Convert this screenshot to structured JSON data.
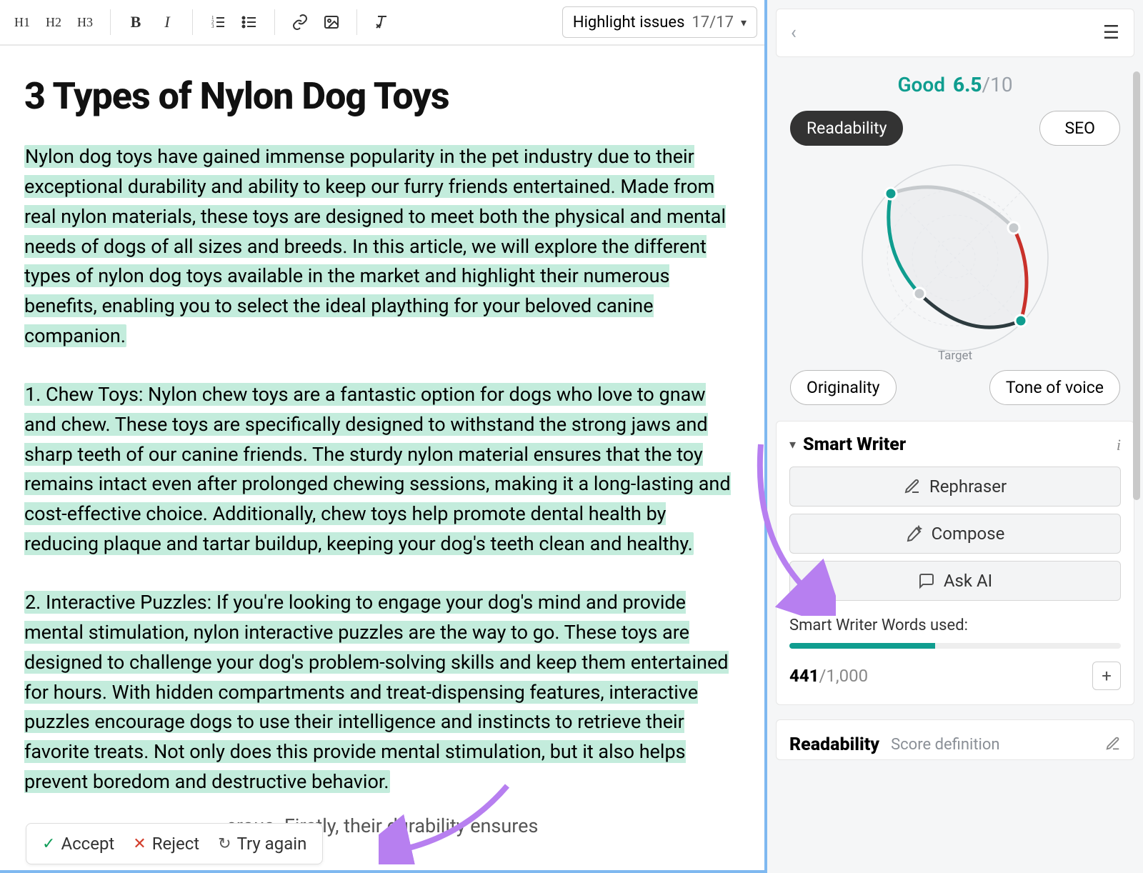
{
  "toolbar": {
    "h1": "H1",
    "h2": "H2",
    "h3": "H3",
    "bold": "B",
    "italic": "I",
    "highlight_label": "Highlight issues",
    "highlight_count": "17/17"
  },
  "document": {
    "title": "3 Types of Nylon Dog Toys",
    "p1": "Nylon dog toys have gained immense popularity in the pet industry due to their exceptional durability and ability to keep our furry friends entertained. Made from real nylon materials, these toys are designed to meet both the physical and mental needs of dogs of all sizes and breeds. In this article, we will explore the different types of nylon dog toys available in the market and highlight their numerous benefits, enabling you to select the ideal plaything for your beloved canine companion.",
    "p2": "1. Chew Toys: Nylon chew toys are a fantastic option for dogs who love to gnaw and chew. These toys are specifically designed to withstand the strong jaws and sharp teeth of our canine friends. The sturdy nylon material ensures that the toy remains intact even after prolonged chewing sessions, making it a long-lasting and cost-effective choice. Additionally, chew toys help promote dental health by reducing plaque and tartar buildup, keeping your dog's teeth clean and healthy.",
    "p3": "2. Interactive Puzzles: If you're looking to engage your dog's mind and provide mental stimulation, nylon interactive puzzles are the way to go. These toys are designed to challenge your dog's problem-solving skills and keep them entertained for hours. With hidden compartments and treat-dispensing features, interactive puzzles encourage dogs to use their intelligence and instincts to retrieve their favorite treats. Not only does this provide mental stimulation, but it also helps prevent boredom and destructive behavior.",
    "p4_fragment": "erous. Firstly, their durability ensures"
  },
  "actions": {
    "accept": "Accept",
    "reject": "Reject",
    "try_again": "Try again"
  },
  "sidebar": {
    "score_label": "Good",
    "score_value": "6.5",
    "score_outof": "/10",
    "pills": {
      "readability": "Readability",
      "seo": "SEO",
      "originality": "Originality",
      "tone": "Tone of voice"
    },
    "target_label": "Target",
    "smart_writer": {
      "title": "Smart Writer",
      "rephraser": "Rephraser",
      "compose": "Compose",
      "ask_ai": "Ask AI",
      "words_label": "Smart Writer Words used:",
      "used": "441",
      "total": "/1,000",
      "progress_pct": 44
    },
    "readability_card": {
      "title": "Readability",
      "definition": "Score definition"
    }
  },
  "colors": {
    "accent_teal": "#0f9d8f",
    "highlight": "#c3ecdc",
    "arrow": "#b77ff0"
  }
}
